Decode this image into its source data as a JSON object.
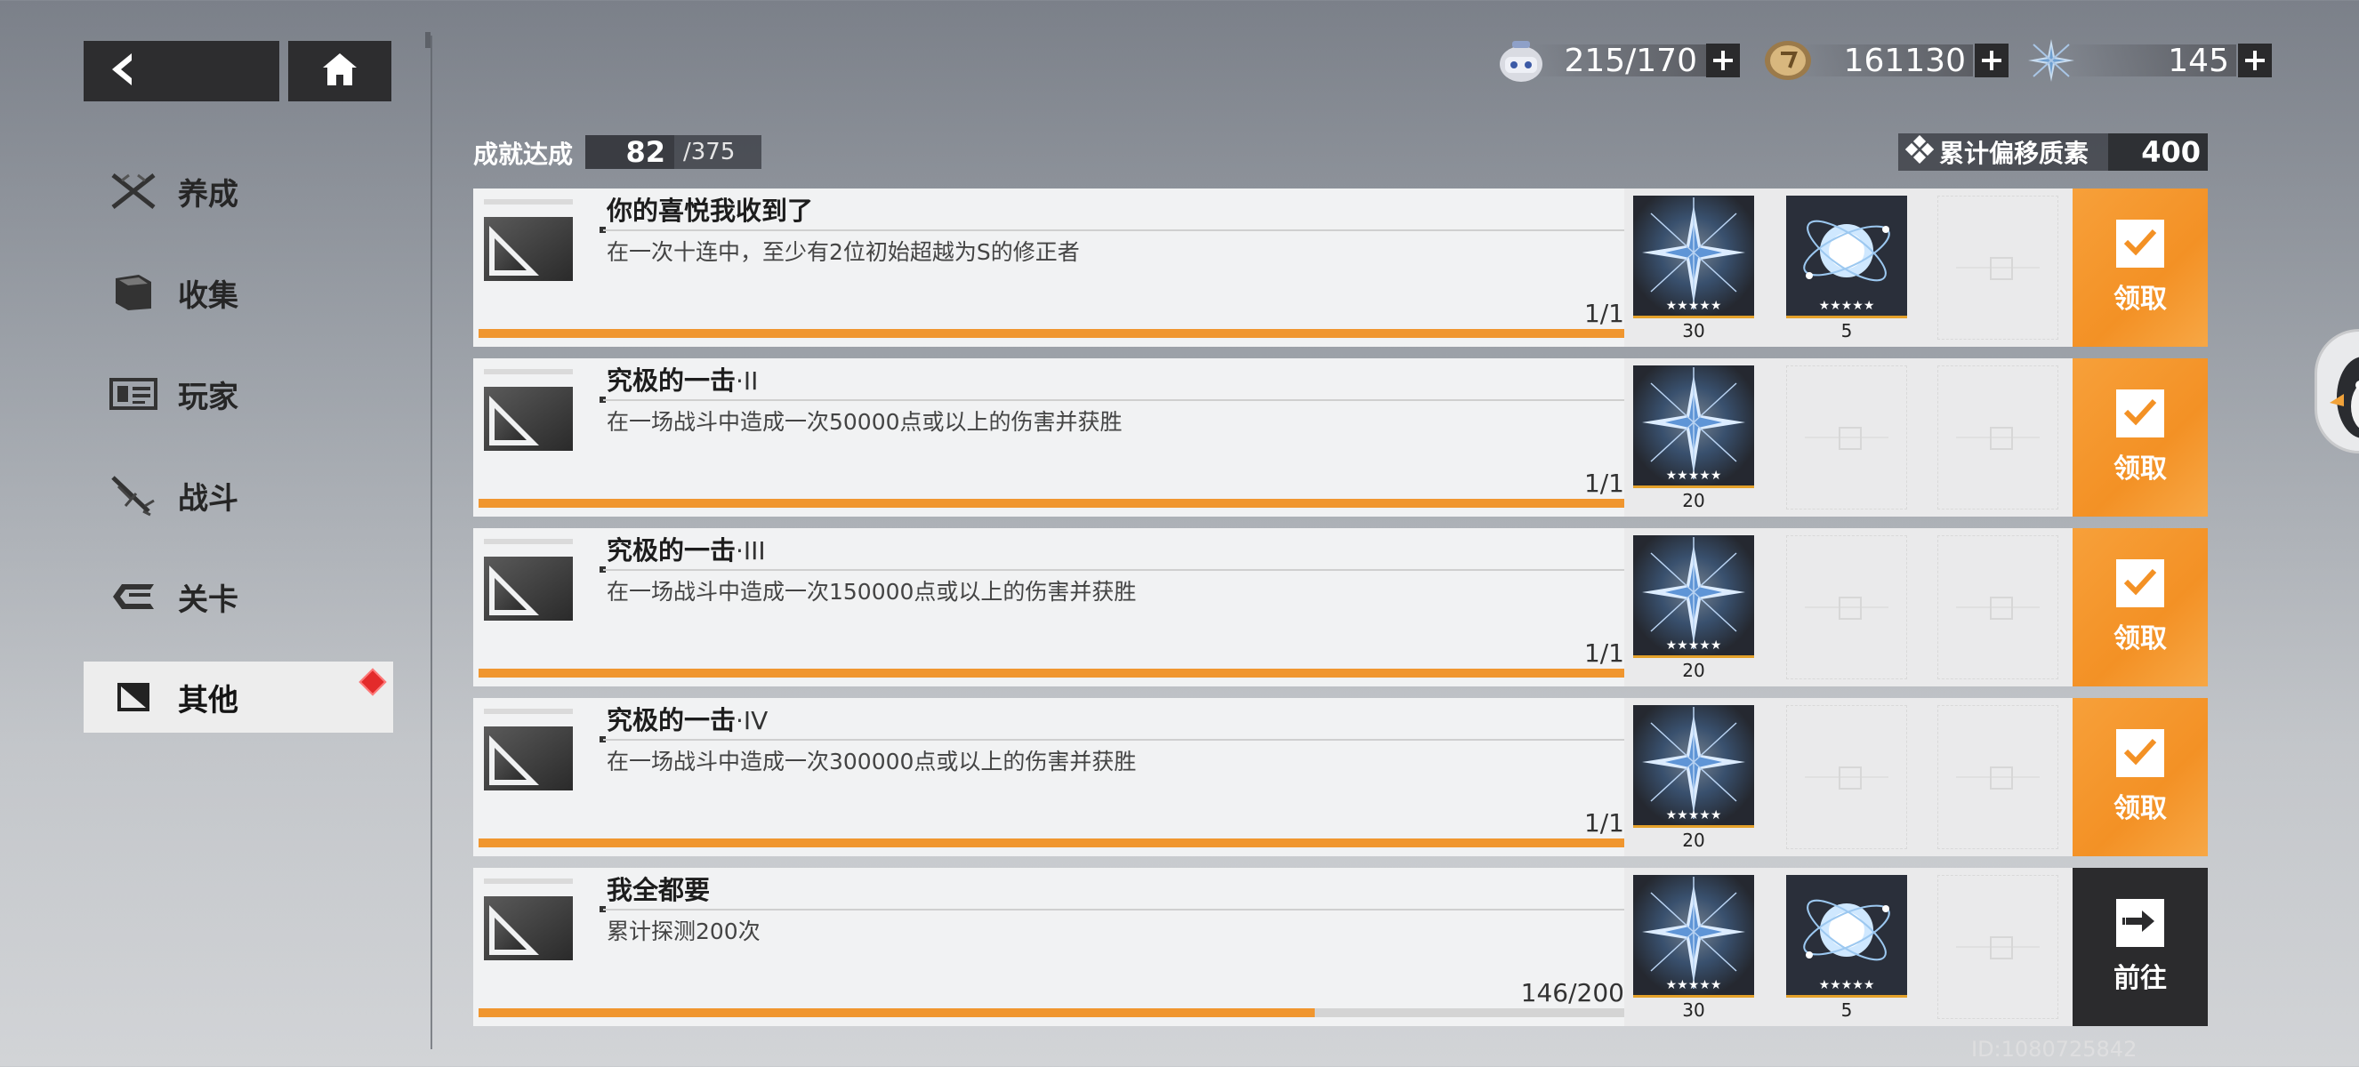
{
  "nav": {
    "back_icon": "back-arrow-icon",
    "home_icon": "home-icon"
  },
  "currencies": [
    {
      "icon": "robot-icon",
      "value": "215/170"
    },
    {
      "icon": "coin-icon",
      "value": "161130"
    },
    {
      "icon": "crystal-icon",
      "value": "145"
    }
  ],
  "sidebar": {
    "items": [
      {
        "label": "养成",
        "icon": "crossed-swords-icon"
      },
      {
        "label": "收集",
        "icon": "folder-icon"
      },
      {
        "label": "玩家",
        "icon": "id-card-icon"
      },
      {
        "label": "战斗",
        "icon": "sword-icon"
      },
      {
        "label": "关卡",
        "icon": "stage-icon"
      },
      {
        "label": "其他",
        "icon": "other-icon",
        "active": true
      }
    ]
  },
  "header": {
    "achievement_label": "成就达成",
    "achievement_count": "82",
    "achievement_total": "/375",
    "drift_label": "累计偏移质素",
    "drift_value": "400"
  },
  "achievements": [
    {
      "title": "你的喜悦我收到了",
      "title_suffix": "",
      "desc": "在一次十连中，至少有2位初始超越为S的修正者",
      "progress": "1/1",
      "fraction": 1.0,
      "rewards": [
        {
          "type": "crystal",
          "qty": "30"
        },
        {
          "type": "orb",
          "qty": "5"
        }
      ],
      "action": "领取",
      "action_type": "claim"
    },
    {
      "title": "究极的一击",
      "title_suffix": "·II",
      "desc": "在一场战斗中造成一次50000点或以上的伤害并获胜",
      "progress": "1/1",
      "fraction": 1.0,
      "rewards": [
        {
          "type": "crystal",
          "qty": "20"
        }
      ],
      "action": "领取",
      "action_type": "claim"
    },
    {
      "title": "究极的一击",
      "title_suffix": "·III",
      "desc": "在一场战斗中造成一次150000点或以上的伤害并获胜",
      "progress": "1/1",
      "fraction": 1.0,
      "rewards": [
        {
          "type": "crystal",
          "qty": "20"
        }
      ],
      "action": "领取",
      "action_type": "claim"
    },
    {
      "title": "究极的一击",
      "title_suffix": "·IV",
      "desc": "在一场战斗中造成一次300000点或以上的伤害并获胜",
      "progress": "1/1",
      "fraction": 1.0,
      "rewards": [
        {
          "type": "crystal",
          "qty": "20"
        }
      ],
      "action": "领取",
      "action_type": "claim"
    },
    {
      "title": "我全都要",
      "title_suffix": "",
      "desc": "累计探测200次",
      "progress": "146/200",
      "fraction": 0.73,
      "rewards": [
        {
          "type": "crystal",
          "qty": "30"
        },
        {
          "type": "orb",
          "qty": "5"
        }
      ],
      "action": "前往",
      "action_type": "go"
    }
  ],
  "footer": {
    "uid": "ID:1080725842"
  },
  "colors": {
    "accent": "#f39125",
    "dark": "#2b2b2d",
    "alert": "#e32b2b"
  }
}
